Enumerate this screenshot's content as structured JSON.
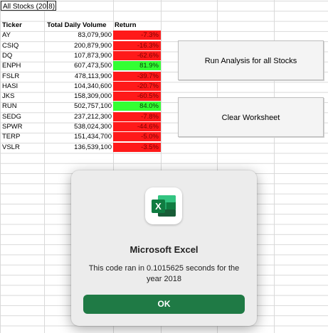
{
  "title_cell": {
    "text_before": "All Stocks (20",
    "text_after": "8)"
  },
  "table": {
    "headers": [
      "Ticker",
      "Total Daily Volume",
      "Return"
    ],
    "rows": [
      {
        "ticker": "AY",
        "volume": "83,079,900",
        "return": "-7.3%",
        "status": "neg"
      },
      {
        "ticker": "CSIQ",
        "volume": "200,879,900",
        "return": "-16.3%",
        "status": "neg"
      },
      {
        "ticker": "DQ",
        "volume": "107,873,900",
        "return": "-62.6%",
        "status": "neg"
      },
      {
        "ticker": "ENPH",
        "volume": "607,473,500",
        "return": "81.9%",
        "status": "pos"
      },
      {
        "ticker": "FSLR",
        "volume": "478,113,900",
        "return": "-39.7%",
        "status": "neg"
      },
      {
        "ticker": "HASI",
        "volume": "104,340,600",
        "return": "-20.7%",
        "status": "neg"
      },
      {
        "ticker": "JKS",
        "volume": "158,309,000",
        "return": "-60.5%",
        "status": "neg"
      },
      {
        "ticker": "RUN",
        "volume": "502,757,100",
        "return": "84.0%",
        "status": "pos"
      },
      {
        "ticker": "SEDG",
        "volume": "237,212,300",
        "return": "-7.8%",
        "status": "neg"
      },
      {
        "ticker": "SPWR",
        "volume": "538,024,300",
        "return": "-44.6%",
        "status": "neg"
      },
      {
        "ticker": "TERP",
        "volume": "151,434,700",
        "return": "-5.0%",
        "status": "neg"
      },
      {
        "ticker": "VSLR",
        "volume": "136,539,100",
        "return": "-3.5%",
        "status": "neg"
      }
    ]
  },
  "buttons": {
    "run_label": "Run Analysis for all Stocks",
    "clear_label": "Clear Worksheet"
  },
  "dialog": {
    "icon": "excel-icon",
    "icon_letter": "X",
    "title": "Microsoft Excel",
    "message": "This code ran in 0.1015625 seconds for the year 2018",
    "ok_label": "OK"
  },
  "colors": {
    "negative": "#ff1a1a",
    "positive": "#33ff33",
    "ok_button": "#1f7a45"
  }
}
